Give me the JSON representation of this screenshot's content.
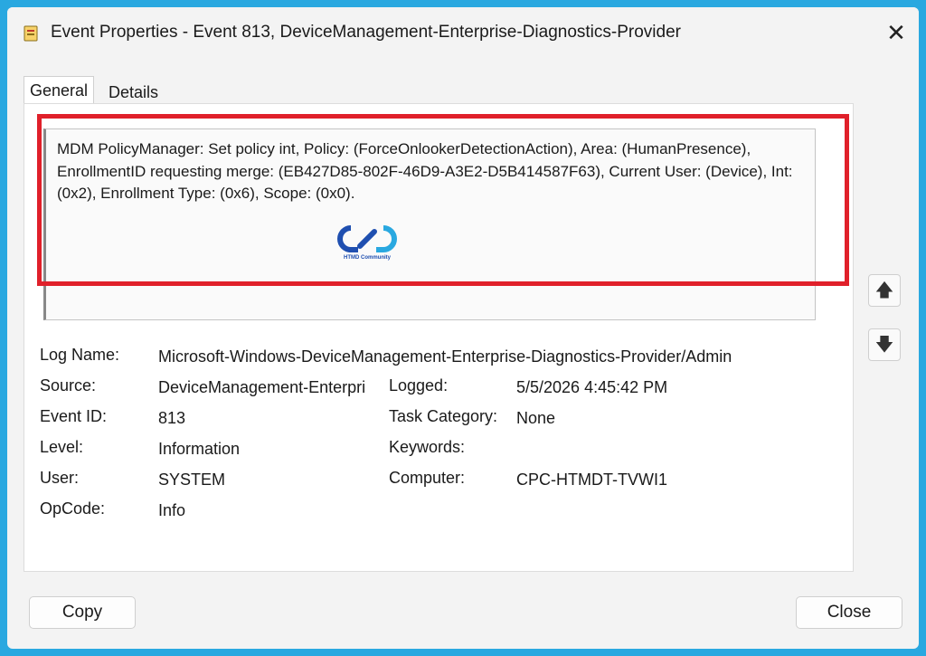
{
  "window": {
    "title": "Event Properties - Event 813, DeviceManagement-Enterprise-Diagnostics-Provider",
    "close_glyph": "✕"
  },
  "tabs": [
    {
      "label": "General",
      "active": true
    },
    {
      "label": "Details",
      "active": false
    }
  ],
  "description": "MDM PolicyManager: Set policy int, Policy: (ForceOnlookerDetectionAction), Area: (HumanPresence), EnrollmentID requesting merge: (EB427D85-802F-46D9-A3E2-D5B414587F63), Current User: (Device), Int: (0x2), Enrollment Type: (0x6), Scope: (0x0).",
  "watermark": {
    "text": "HTMD Community",
    "icon": "htmd-logo-icon"
  },
  "nav": {
    "up_glyph": "🡅",
    "down_glyph": "🡇"
  },
  "details": {
    "log_name_label": "Log Name:",
    "log_name": "Microsoft-Windows-DeviceManagement-Enterprise-Diagnostics-Provider/Admin",
    "source_label": "Source:",
    "source": "DeviceManagement-Enterpri",
    "logged_label": "Logged:",
    "logged": "5/5/2026 4:45:42 PM",
    "event_id_label": "Event ID:",
    "event_id": "813",
    "task_category_label": "Task Category:",
    "task_category": "None",
    "level_label": "Level:",
    "level": "Information",
    "keywords_label": "Keywords:",
    "keywords": "",
    "user_label": "User:",
    "user": "SYSTEM",
    "computer_label": "Computer:",
    "computer": "CPC-HTMDT-TVWI1",
    "opcode_label": "OpCode:",
    "opcode": "Info"
  },
  "buttons": {
    "copy": "Copy",
    "close": "Close"
  },
  "colors": {
    "highlight": "#e0202a",
    "background": "#29a8e0",
    "logo": "#1f4fb0"
  }
}
